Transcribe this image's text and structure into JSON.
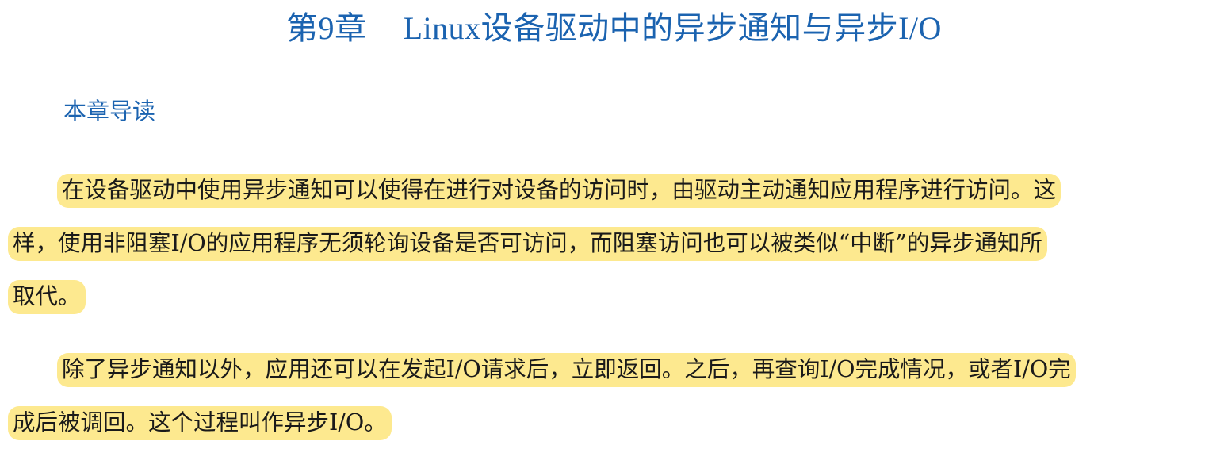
{
  "chapter": {
    "number": "第9章",
    "title": "Linux设备驱动中的异步通知与异步I/O"
  },
  "section": {
    "heading": "本章导读"
  },
  "paragraphs": [
    {
      "lines": [
        "在设备驱动中使用异步通知可以使得在进行对设备的访问时，由驱动主动通知应用程序进行访问。这",
        "样，使用非阻塞I/O的应用程序无须轮询设备是否可访问，而阻塞访问也可以被类似“中断”的异步通知所",
        "取代。"
      ]
    },
    {
      "lines": [
        "除了异步通知以外，应用还可以在发起I/O请求后，立即返回。之后，再查询I/O完成情况，或者I/O完",
        "成后被调回。这个过程叫作异步I/O。"
      ]
    }
  ],
  "colors": {
    "heading_blue": "#1b63b0",
    "highlight_yellow": "#fde98f",
    "body_text": "#1a1a1a"
  }
}
